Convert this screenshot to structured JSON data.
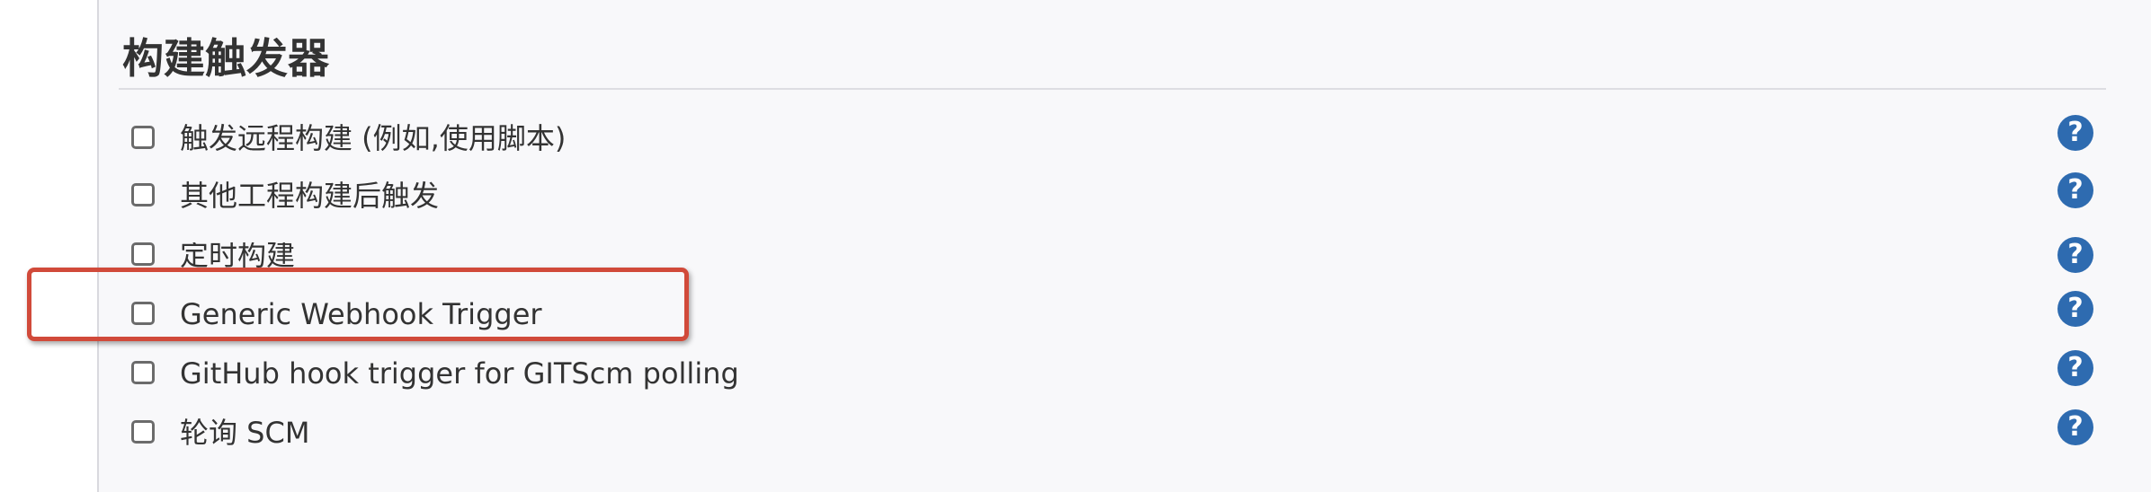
{
  "section": {
    "title": "构建触发器"
  },
  "options": [
    {
      "label": "触发远程构建 (例如,使用脚本)",
      "checked": false,
      "help_icon": "help-icon"
    },
    {
      "label": "其他工程构建后触发",
      "checked": false,
      "help_icon": "help-icon"
    },
    {
      "label": "定时构建",
      "checked": false,
      "help_icon": "help-icon"
    },
    {
      "label": "Generic Webhook Trigger",
      "checked": false,
      "help_icon": "help-icon"
    },
    {
      "label": "GitHub hook trigger for GITScm polling",
      "checked": false,
      "help_icon": "help-icon"
    },
    {
      "label": "轮询 SCM",
      "checked": false,
      "help_icon": "help-icon"
    }
  ],
  "help_glyph": "?",
  "colors": {
    "panel_bg": "#f8f8fa",
    "help_icon": "#2e6bb0",
    "highlight": "#d14a3a",
    "text": "#333333"
  }
}
